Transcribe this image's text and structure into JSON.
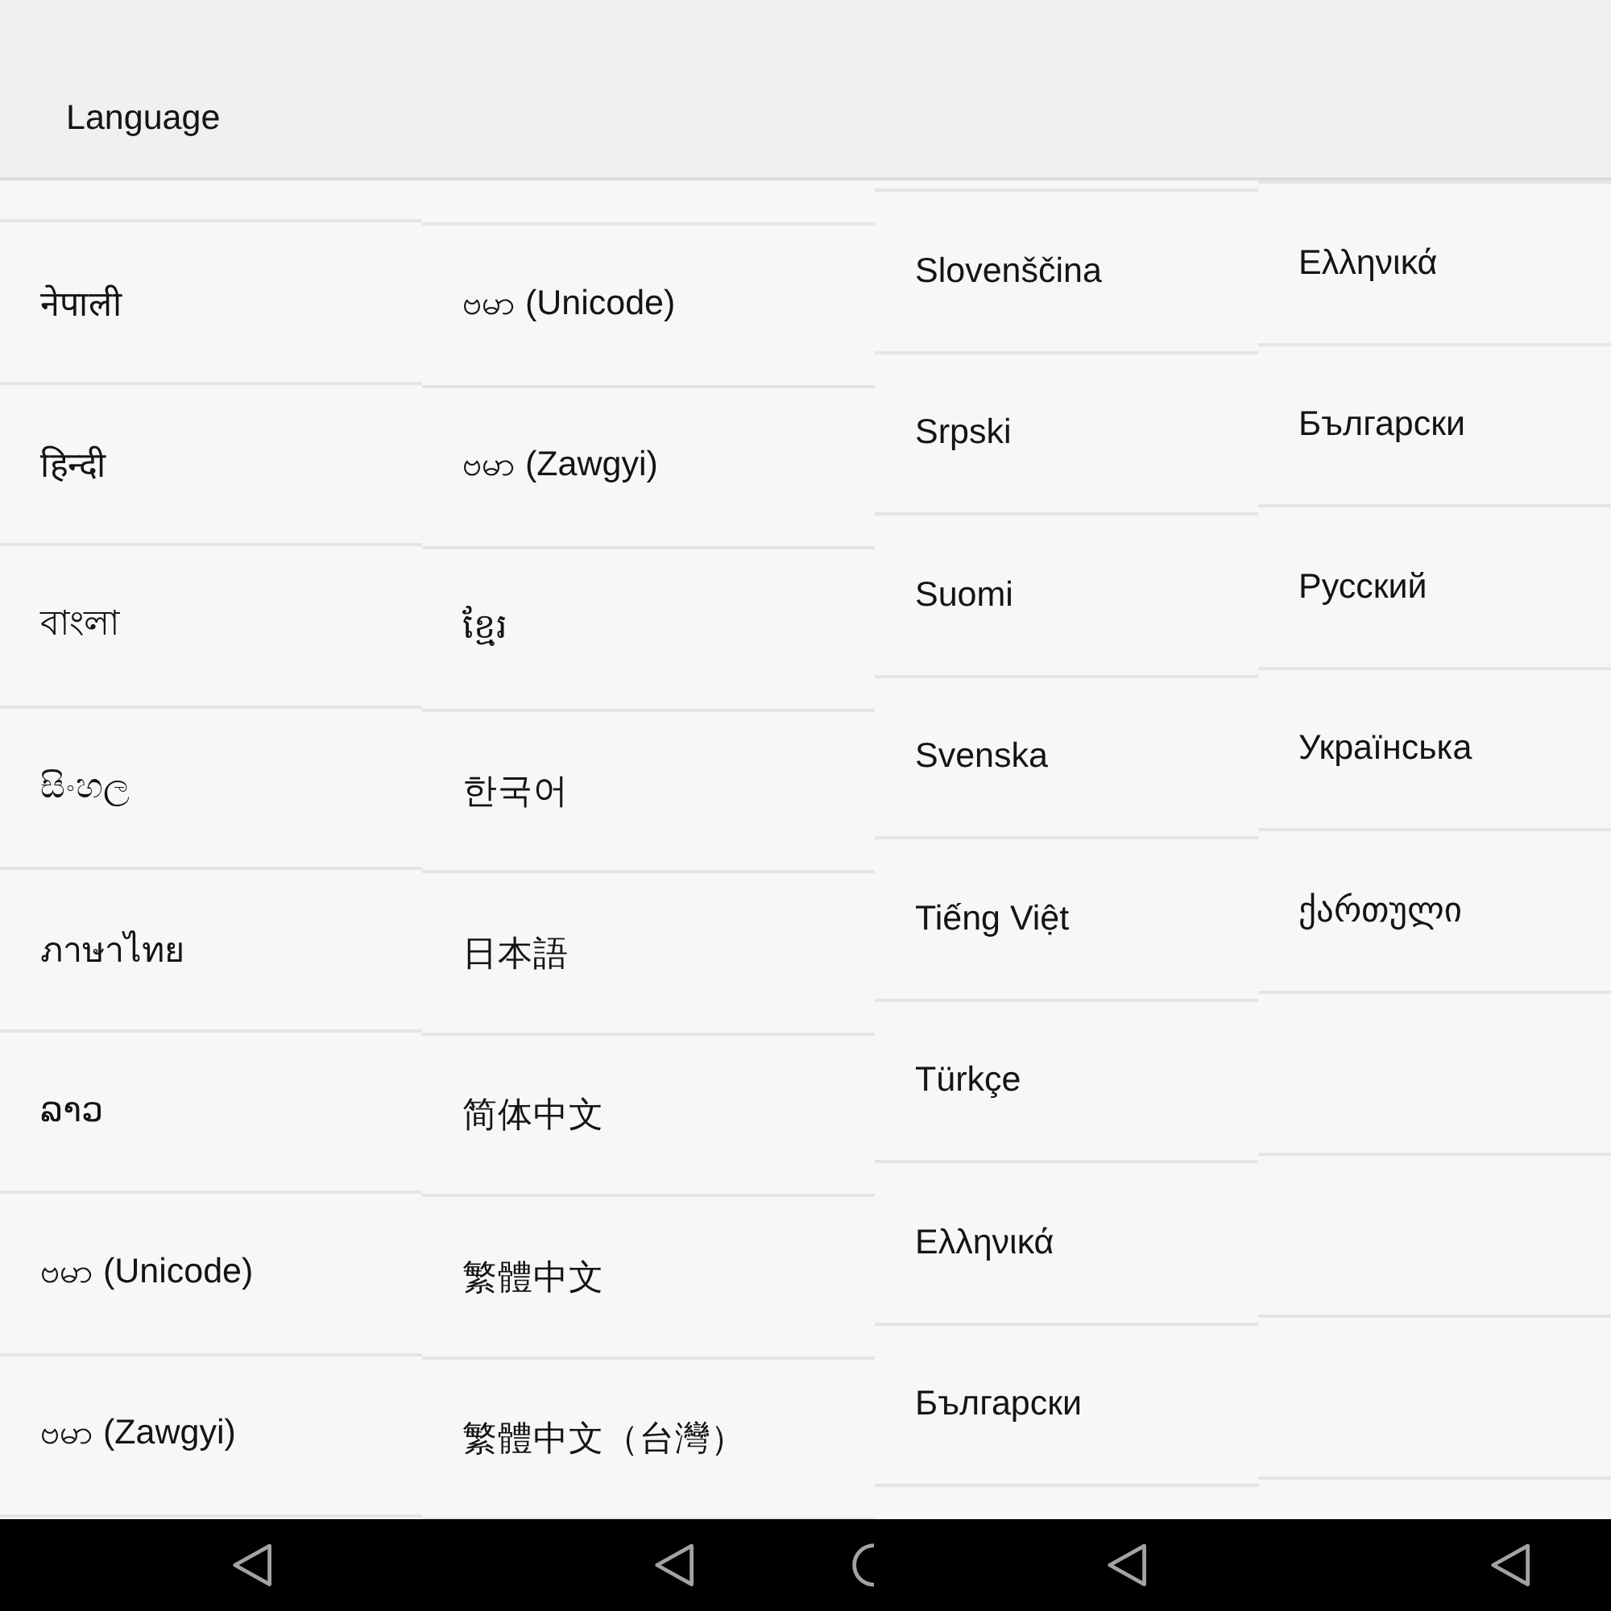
{
  "app_bar": {
    "title": "Language"
  },
  "columns": [
    {
      "items": [
        "नेपाली",
        "हिन्दी",
        "বাংলা",
        "සිංහල",
        "ภาษาไทย",
        "ລາວ",
        "ဗမာ (Unicode)",
        "ဗမာ (Zawgyi)"
      ]
    },
    {
      "items": [
        "ဗမာ (Unicode)",
        "ဗမာ (Zawgyi)",
        "ខ្មែរ",
        "한국어",
        "日本語",
        "简体中文",
        "繁體中文",
        "繁體中文（台灣）"
      ]
    },
    {
      "items": [
        "Slovenščina",
        "Srpski",
        "Suomi",
        "Svenska",
        "Tiếng Việt",
        "Türkçe",
        "Ελληνικά",
        "Български"
      ]
    },
    {
      "items": [
        "Ελληνικά",
        "Български",
        "Русский",
        "Українська",
        "ქართული"
      ]
    }
  ]
}
